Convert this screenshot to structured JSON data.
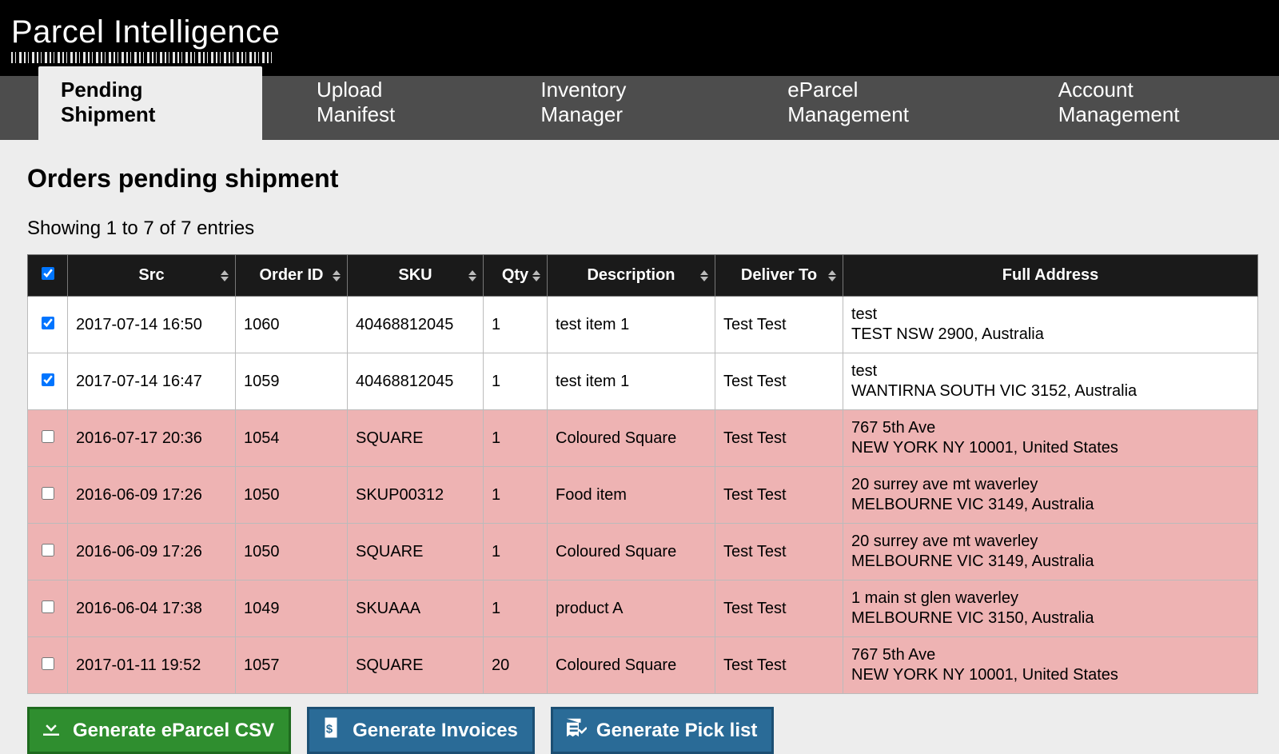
{
  "brand": "Parcel Intelligence",
  "tabs": [
    {
      "label": "Pending Shipment",
      "active": true
    },
    {
      "label": "Upload Manifest",
      "active": false
    },
    {
      "label": "Inventory Manager",
      "active": false
    },
    {
      "label": "eParcel Management",
      "active": false
    },
    {
      "label": "Account Management",
      "active": false
    }
  ],
  "page_title": "Orders pending shipment",
  "showing_text": "Showing 1 to 7 of 7 entries",
  "table": {
    "headers": [
      "Src",
      "Order ID",
      "SKU",
      "Qty",
      "Description",
      "Deliver To",
      "Full Address"
    ],
    "rows": [
      {
        "checked": true,
        "pink": false,
        "src": "2017-07-14 16:50",
        "order_id": "1060",
        "sku": "40468812045",
        "qty": "1",
        "desc": "test item 1",
        "deliver": "Test Test",
        "addr1": "test",
        "addr2": "TEST NSW 2900, Australia"
      },
      {
        "checked": true,
        "pink": false,
        "src": "2017-07-14 16:47",
        "order_id": "1059",
        "sku": "40468812045",
        "qty": "1",
        "desc": "test item 1",
        "deliver": "Test Test",
        "addr1": "test",
        "addr2": "WANTIRNA SOUTH VIC 3152, Australia"
      },
      {
        "checked": false,
        "pink": true,
        "src": "2016-07-17 20:36",
        "order_id": "1054",
        "sku": "SQUARE",
        "qty": "1",
        "desc": "Coloured Square",
        "deliver": "Test Test",
        "addr1": "767 5th Ave",
        "addr2": "NEW YORK NY 10001, United States"
      },
      {
        "checked": false,
        "pink": true,
        "src": "2016-06-09 17:26",
        "order_id": "1050",
        "sku": "SKUP00312",
        "qty": "1",
        "desc": "Food item",
        "deliver": "Test Test",
        "addr1": "20 surrey ave mt waverley",
        "addr2": "MELBOURNE VIC 3149, Australia"
      },
      {
        "checked": false,
        "pink": true,
        "src": "2016-06-09 17:26",
        "order_id": "1050",
        "sku": "SQUARE",
        "qty": "1",
        "desc": "Coloured Square",
        "deliver": "Test Test",
        "addr1": "20 surrey ave mt waverley",
        "addr2": "MELBOURNE VIC 3149, Australia"
      },
      {
        "checked": false,
        "pink": true,
        "src": "2016-06-04 17:38",
        "order_id": "1049",
        "sku": "SKUAAA",
        "qty": "1",
        "desc": "product A",
        "deliver": "Test Test",
        "addr1": "1 main st glen waverley",
        "addr2": "MELBOURNE VIC 3150, Australia"
      },
      {
        "checked": false,
        "pink": true,
        "src": "2017-01-11 19:52",
        "order_id": "1057",
        "sku": "SQUARE",
        "qty": "20",
        "desc": "Coloured Square",
        "deliver": "Test Test",
        "addr1": "767 5th Ave",
        "addr2": "NEW YORK NY 10001, United States"
      }
    ]
  },
  "buttons": {
    "csv": "Generate eParcel CSV",
    "invoices": "Generate Invoices",
    "picklist": "Generate Pick list"
  }
}
